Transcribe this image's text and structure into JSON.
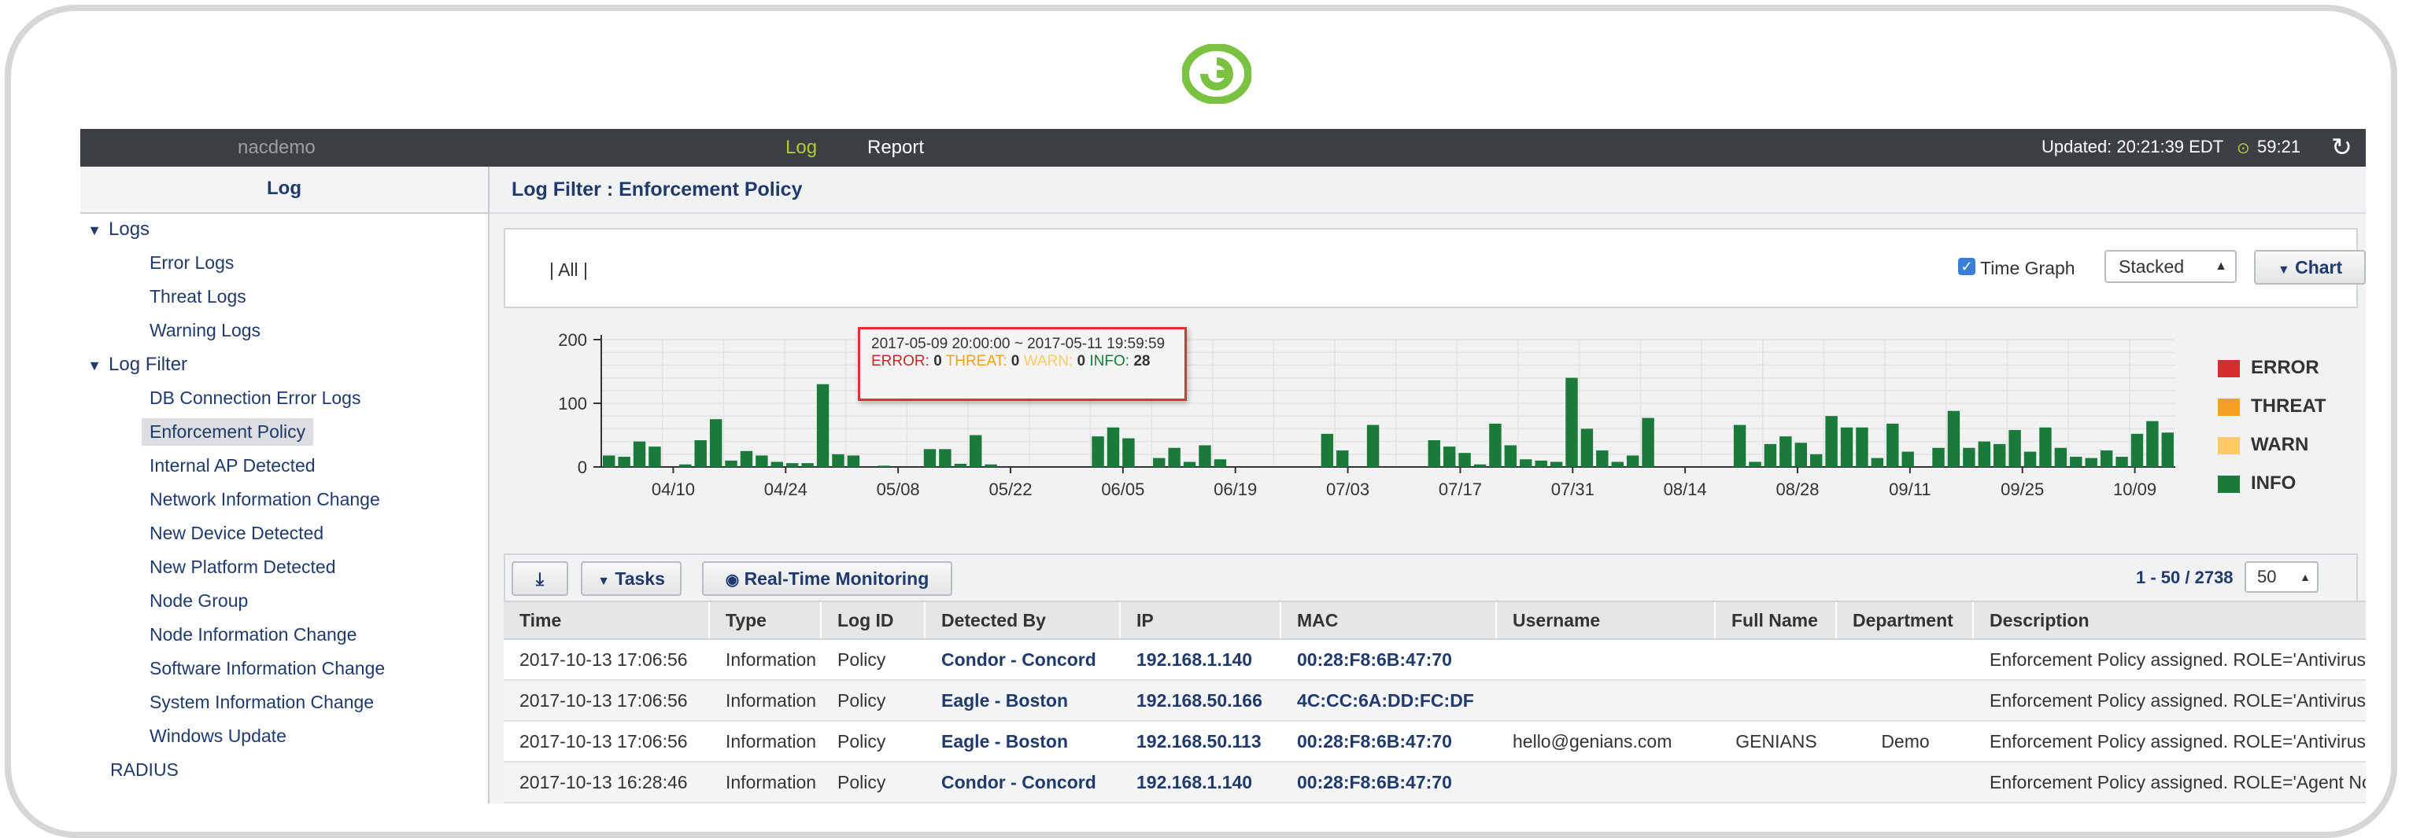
{
  "topbar": {
    "brand": "nacdemo",
    "nav": [
      "Log",
      "Report"
    ],
    "updated": "Updated: 20:21:39 EDT",
    "timer": "59:21",
    "timer_icon": "clock-icon",
    "refresh_icon": "refresh-icon"
  },
  "sidebar": {
    "title": "Log",
    "groups": [
      {
        "label": "Logs",
        "items": [
          "Error Logs",
          "Threat Logs",
          "Warning Logs"
        ]
      },
      {
        "label": "Log Filter",
        "items": [
          "DB Connection Error Logs",
          "Enforcement Policy",
          "Internal AP Detected",
          "Network Information Change",
          "New Device Detected",
          "New Platform Detected",
          "Node Group",
          "Node Information Change",
          "Software Information Change",
          "System Information Change",
          "Windows Update"
        ]
      }
    ],
    "selected": "Enforcement Policy",
    "extra": "RADIUS"
  },
  "main": {
    "title": "Log Filter : Enforcement Policy",
    "filter_all": "| All |",
    "time_graph_label": "Time Graph",
    "time_graph_checked": true,
    "chart_mode": "Stacked",
    "chart_button": "Chart"
  },
  "tooltip": {
    "range": "2017-05-09 20:00:00 ~ 2017-05-11 19:59:59",
    "error_label": "ERROR:",
    "error": "0",
    "threat_label": "THREAT:",
    "threat": "0",
    "warn_label": "WARN:",
    "warn": "0",
    "info_label": "INFO:",
    "info": "28"
  },
  "chart_data": {
    "type": "bar",
    "stacked": true,
    "ylim": [
      0,
      200
    ],
    "yticks": [
      "0",
      "100",
      "200"
    ],
    "xticks": [
      "04/10",
      "04/24",
      "05/08",
      "05/22",
      "06/05",
      "06/19",
      "07/03",
      "07/17",
      "07/31",
      "08/14",
      "08/28",
      "09/11",
      "09/25",
      "10/09"
    ],
    "series": [
      {
        "name": "ERROR",
        "color": "#d32f2f"
      },
      {
        "name": "THREAT",
        "color": "#f5a020"
      },
      {
        "name": "WARN",
        "color": "#ffc966"
      },
      {
        "name": "INFO",
        "color": "#1a7a3a",
        "values": [
          18,
          16,
          40,
          32,
          0,
          4,
          42,
          75,
          10,
          25,
          18,
          8,
          6,
          6,
          130,
          20,
          18,
          0,
          2,
          0,
          0,
          28,
          28,
          5,
          50,
          4,
          0,
          0,
          0,
          0,
          0,
          0,
          48,
          62,
          45,
          0,
          14,
          30,
          8,
          34,
          12,
          0,
          0,
          0,
          0,
          0,
          0,
          52,
          26,
          0,
          66,
          0,
          0,
          0,
          42,
          32,
          22,
          4,
          68,
          34,
          12,
          10,
          8,
          140,
          60,
          26,
          8,
          18,
          77,
          0,
          0,
          0,
          0,
          0,
          66,
          8,
          36,
          48,
          38,
          20,
          80,
          62,
          62,
          14,
          68,
          24,
          0,
          30,
          88,
          30,
          40,
          36,
          58,
          24,
          62,
          30,
          16,
          14,
          26,
          16,
          52,
          72,
          54
        ]
      }
    ]
  },
  "toolbar": {
    "download_icon": "download-icon",
    "tasks": "Tasks",
    "realtime": "Real-Time Monitoring",
    "realtime_icon": "eye-icon",
    "paging": "1 - 50 / 2738",
    "page_size": "50"
  },
  "table": {
    "columns": [
      "Time",
      "Type",
      "Log ID",
      "Detected By",
      "IP",
      "MAC",
      "Username",
      "Full Name",
      "Department",
      "Description"
    ],
    "rows": [
      [
        "2017-10-13 17:06:56",
        "Information",
        "Policy",
        "Condor - Concord",
        "192.168.1.140",
        "00:28:F8:6B:47:70",
        "",
        "",
        "",
        "Enforcement Policy assigned. ROLE='Antivirus No"
      ],
      [
        "2017-10-13 17:06:56",
        "Information",
        "Policy",
        "Eagle - Boston",
        "192.168.50.166",
        "4C:CC:6A:DD:FC:DF",
        "",
        "",
        "",
        "Enforcement Policy assigned. ROLE='Antivirus No"
      ],
      [
        "2017-10-13 17:06:56",
        "Information",
        "Policy",
        "Eagle - Boston",
        "192.168.50.113",
        "00:28:F8:6B:47:70",
        "hello@genians.com",
        "GENIANS",
        "Demo",
        "Enforcement Policy assigned. ROLE='Antivirus No"
      ],
      [
        "2017-10-13 16:28:46",
        "Information",
        "Policy",
        "Condor - Concord",
        "192.168.1.140",
        "00:28:F8:6B:47:70",
        "",
        "",
        "",
        "Enforcement Policy assigned. ROLE='Agent Not F"
      ]
    ]
  }
}
